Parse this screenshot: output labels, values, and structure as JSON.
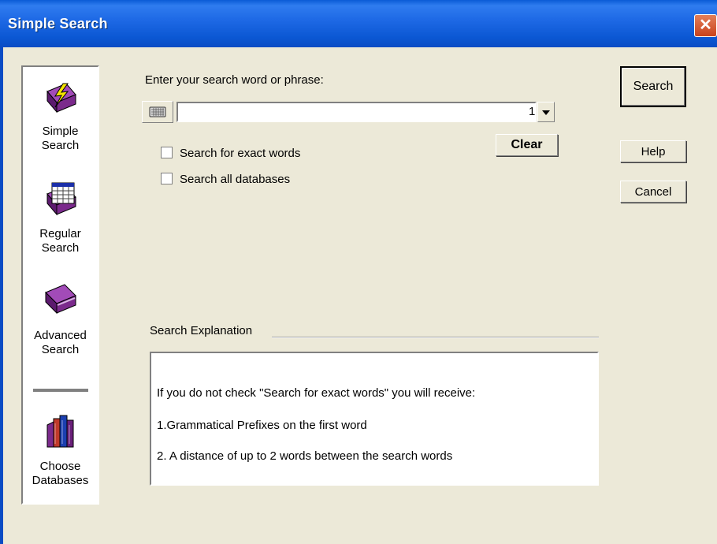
{
  "window": {
    "title": "Simple Search",
    "close_icon": "close-icon"
  },
  "sidebar": {
    "items": [
      {
        "label_line1": "Simple",
        "label_line2": "Search",
        "icon": "lightning-book-icon"
      },
      {
        "label_line1": "Regular",
        "label_line2": "Search",
        "icon": "grid-book-icon"
      },
      {
        "label_line1": "Advanced",
        "label_line2": "Search",
        "icon": "book-icon"
      },
      {
        "label_line1": "Choose",
        "label_line2": "Databases",
        "icon": "books-icon"
      }
    ]
  },
  "search": {
    "prompt": "Enter your search word or phrase:",
    "value": "",
    "placeholder": "",
    "combo_value": "1",
    "keyboard_icon": "keyboard-icon",
    "clear_label": "Clear"
  },
  "options": {
    "exact_words": {
      "label": "Search for exact words",
      "checked": false
    },
    "all_databases": {
      "label": "Search all databases",
      "checked": false
    }
  },
  "buttons": {
    "search": "Search",
    "help": "Help",
    "cancel": "Cancel"
  },
  "explanation": {
    "heading": "Search Explanation",
    "lines": [
      "If you do not check \"Search for exact words\" you will receive:",
      "1.Grammatical Prefixes on the first word",
      "2. A distance of up to 2 words between the search words"
    ]
  },
  "colors": {
    "titlebar": "#0a5bd6",
    "dialog_bg": "#ece9d8",
    "close": "#c8421c",
    "book_purple": "#7b2a8c"
  }
}
